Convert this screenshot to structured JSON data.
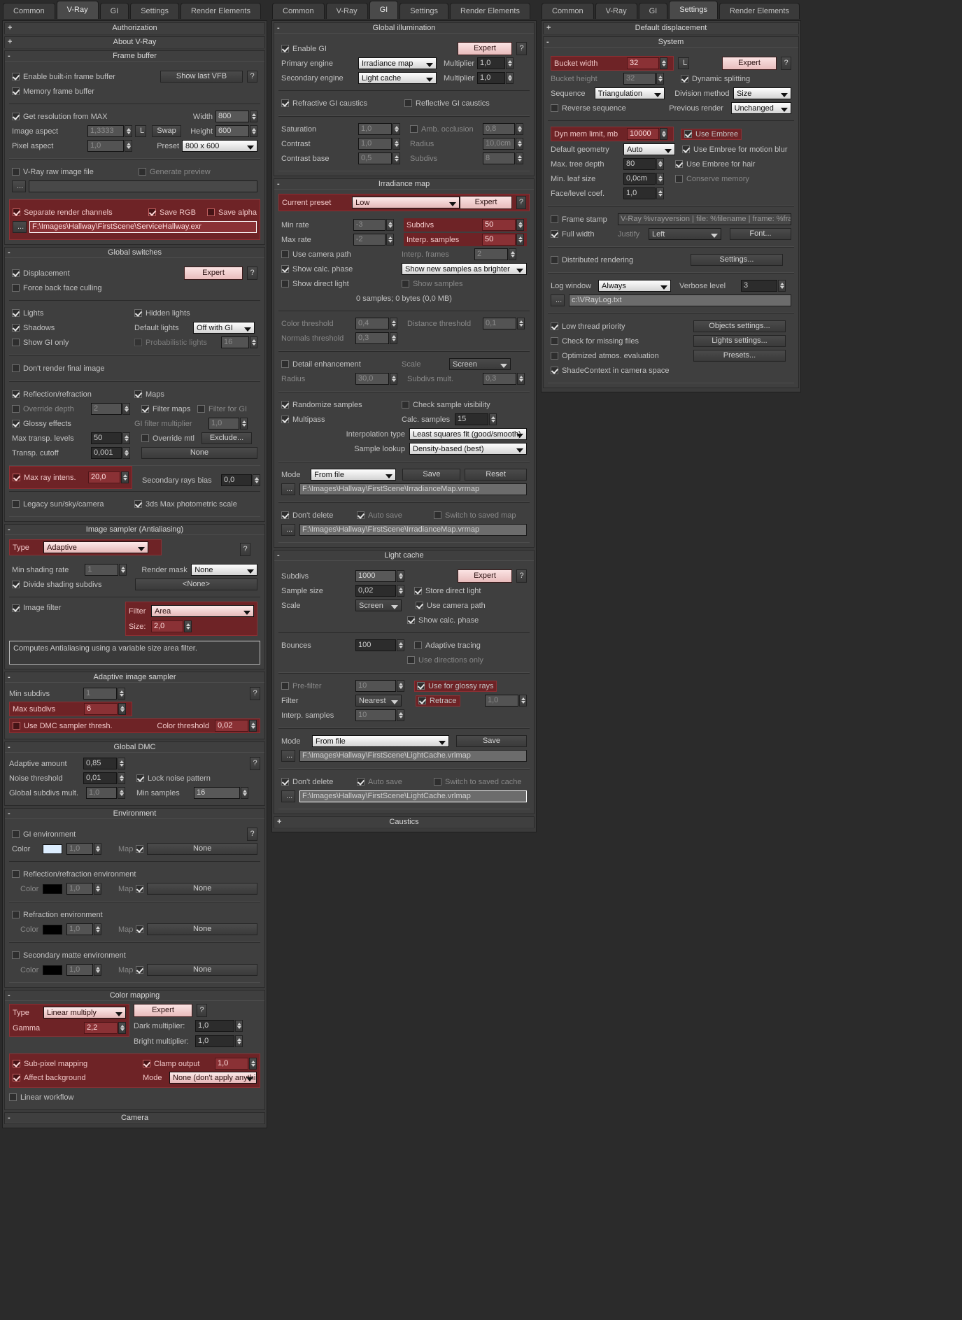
{
  "columns": [
    {
      "id": "vray",
      "tabs": [
        "Common",
        "V-Ray",
        "GI",
        "Settings",
        "Render Elements"
      ],
      "active_tab": "V-Ray"
    },
    {
      "id": "gi",
      "tabs": [
        "Common",
        "V-Ray",
        "GI",
        "Settings",
        "Render Elements"
      ],
      "active_tab": "GI"
    },
    {
      "id": "settings",
      "tabs": [
        "Common",
        "V-Ray",
        "GI",
        "Settings",
        "Render Elements"
      ],
      "active_tab": "Settings"
    }
  ],
  "vray": {
    "authorization": {
      "title": "Authorization",
      "state": "+"
    },
    "about": {
      "title": "About V-Ray",
      "state": "+"
    },
    "frame_buffer": {
      "title": "Frame buffer",
      "state": "-",
      "enable_builtin": "Enable built-in frame buffer",
      "memory_frame_buffer": "Memory frame buffer",
      "show_last_vfb": "Show last VFB",
      "help": "?",
      "get_resolution": "Get resolution from MAX",
      "image_aspect_label": "Image aspect",
      "image_aspect_value": "1,3333",
      "pixel_aspect_label": "Pixel aspect",
      "pixel_aspect_value": "1,0",
      "lock_label": "L",
      "swap": "Swap",
      "width_label": "Width",
      "width_value": "800",
      "height_label": "Height",
      "height_value": "600",
      "preset_label": "Preset",
      "preset_value": "800 x 600",
      "raw_image_file": "V-Ray raw image file",
      "generate_preview": "Generate preview",
      "raw_path": "",
      "dots": "...",
      "separate_render_channels": "Separate render channels",
      "save_rgb": "Save RGB",
      "save_alpha": "Save alpha",
      "channels_path": "F:\\Images\\Hallway\\FirstScene\\ServiceHallway.exr"
    },
    "global_switches": {
      "title": "Global switches",
      "state": "-",
      "displacement": "Displacement",
      "force_back_face_culling": "Force back face culling",
      "expert": "Expert",
      "help": "?",
      "lights": "Lights",
      "shadows": "Shadows",
      "show_gi_only": "Show GI only",
      "hidden_lights": "Hidden lights",
      "default_lights_label": "Default lights",
      "default_lights_value": "Off with GI",
      "probabilistic_lights": "Probabilistic lights",
      "probabilistic_lights_value": "16",
      "dont_render_final": "Don't render final image",
      "reflection_refraction": "Reflection/refraction",
      "override_depth": "Override depth",
      "override_depth_value": "2",
      "glossy_effects": "Glossy effects",
      "max_transp_levels_label": "Max transp. levels",
      "max_transp_levels_value": "50",
      "transp_cutoff_label": "Transp. cutoff",
      "transp_cutoff_value": "0,001",
      "maps": "Maps",
      "filter_maps": "Filter maps",
      "filter_for_gi": "Filter for GI",
      "gi_filter_multiplier_label": "GI filter multiplier",
      "gi_filter_multiplier_value": "1,0",
      "override_mtl": "Override mtl",
      "exclude": "Exclude...",
      "override_mtl_slot": "None",
      "max_ray_intens": "Max ray intens.",
      "max_ray_intens_value": "20,0",
      "secondary_rays_bias_label": "Secondary rays bias",
      "secondary_rays_bias_value": "0,0",
      "legacy_sun": "Legacy sun/sky/camera",
      "photometric_scale": "3ds Max photometric scale"
    },
    "image_sampler": {
      "title": "Image sampler (Antialiasing)",
      "state": "-",
      "type_label": "Type",
      "type_value": "Adaptive",
      "help": "?",
      "min_shading_rate_label": "Min shading rate",
      "min_shading_rate_value": "1",
      "render_mask_label": "Render mask",
      "render_mask_value": "None",
      "divide_shading_subdivs": "Divide shading subdivs",
      "mask_slot": "<None>",
      "image_filter": "Image filter",
      "filter_label": "Filter",
      "filter_value": "Area",
      "size_label": "Size:",
      "size_value": "2,0",
      "description": "Computes Antialiasing using a variable size area filter."
    },
    "adaptive_image_sampler": {
      "title": "Adaptive image sampler",
      "state": "-",
      "min_subdivs_label": "Min subdivs",
      "min_subdivs_value": "1",
      "max_subdivs_label": "Max subdivs",
      "max_subdivs_value": "6",
      "help": "?",
      "use_dmc_sampler_thresh": "Use DMC sampler thresh.",
      "color_threshold_label": "Color threshold",
      "color_threshold_value": "0,02"
    },
    "global_dmc": {
      "title": "Global DMC",
      "state": "-",
      "adaptive_amount_label": "Adaptive amount",
      "adaptive_amount_value": "0,85",
      "help": "?",
      "noise_threshold_label": "Noise threshold",
      "noise_threshold_value": "0,01",
      "lock_noise_pattern": "Lock noise pattern",
      "global_subdivs_mult_label": "Global subdivs mult.",
      "global_subdivs_mult_value": "1,0",
      "min_samples_label": "Min samples",
      "min_samples_value": "16"
    },
    "environment": {
      "title": "Environment",
      "state": "-",
      "help": "?",
      "gi_environment": "GI environment",
      "gi_color": "#ddeeff",
      "gi_mult": "1,0",
      "gi_map_label": "Map",
      "gi_map_value": "None",
      "color_label": "Color",
      "refl_environment": "Reflection/refraction environment",
      "refl_color": "#000000",
      "refl_mult": "1,0",
      "refl_map_value": "None",
      "refr_environment": "Refraction environment",
      "refr_color": "#000000",
      "refr_mult": "1,0",
      "refr_map_value": "None",
      "matte_environment": "Secondary matte environment",
      "matte_color": "#000000",
      "matte_mult": "1,0",
      "matte_map_value": "None",
      "map_label": "Map"
    },
    "color_mapping": {
      "title": "Color mapping",
      "state": "-",
      "type_label": "Type",
      "type_value": "Linear multiply",
      "expert": "Expert",
      "help": "?",
      "gamma_label": "Gamma",
      "gamma_value": "2,2",
      "dark_multiplier_label": "Dark multiplier:",
      "dark_multiplier_value": "1,0",
      "bright_multiplier_label": "Bright multiplier:",
      "bright_multiplier_value": "1,0",
      "sub_pixel_mapping": "Sub-pixel mapping",
      "affect_background": "Affect background",
      "linear_workflow": "Linear workflow",
      "clamp_output": "Clamp output",
      "clamp_level_value": "1,0",
      "mode_label": "Mode",
      "mode_value": "None (don't apply anything)"
    },
    "camera": {
      "title": "Camera",
      "state": "-"
    }
  },
  "gi": {
    "global_illumination": {
      "title": "Global illumination",
      "state": "-",
      "enable_gi": "Enable GI",
      "expert": "Expert",
      "help": "?",
      "primary_engine_label": "Primary engine",
      "primary_engine_value": "Irradiance map",
      "primary_multiplier_label": "Multiplier",
      "primary_multiplier_value": "1,0",
      "secondary_engine_label": "Secondary engine",
      "secondary_engine_value": "Light cache",
      "secondary_multiplier_label": "Multiplier",
      "secondary_multiplier_value": "1,0",
      "refractive_caustics": "Refractive GI caustics",
      "reflective_caustics": "Reflective GI caustics",
      "saturation_label": "Saturation",
      "saturation_value": "1,0",
      "contrast_label": "Contrast",
      "contrast_value": "1,0",
      "contrast_base_label": "Contrast base",
      "contrast_base_value": "0,5",
      "amb_occlusion": "Amb. occlusion",
      "amb_occlusion_value": "0,8",
      "radius_label": "Radius",
      "radius_value": "10,0cm",
      "subdivs_label": "Subdivs",
      "subdivs_value": "8"
    },
    "irradiance_map": {
      "title": "Irradiance map",
      "state": "-",
      "current_preset_label": "Current preset",
      "current_preset_value": "Low",
      "expert": "Expert",
      "help": "?",
      "min_rate_label": "Min rate",
      "min_rate_value": "-3",
      "max_rate_label": "Max rate",
      "max_rate_value": "-2",
      "subdivs_label": "Subdivs",
      "subdivs_value": "50",
      "interp_samples_label": "Interp. samples",
      "interp_samples_value": "50",
      "interp_frames_label": "Interp. frames",
      "interp_frames_value": "2",
      "use_camera_path": "Use camera path",
      "show_calc_phase": "Show calc. phase",
      "show_direct_light": "Show direct light",
      "display_mode_value": "Show new samples as brighter",
      "show_samples": "Show samples",
      "stats": "0 samples; 0 bytes (0,0 MB)",
      "color_threshold_label": "Color threshold",
      "color_threshold_value": "0,4",
      "normals_threshold_label": "Normals threshold",
      "normals_threshold_value": "0,3",
      "distance_threshold_label": "Distance threshold",
      "distance_threshold_value": "0,1",
      "detail_enhancement": "Detail enhancement",
      "scale_label": "Scale",
      "scale_value": "Screen",
      "de_radius_label": "Radius",
      "de_radius_value": "30,0",
      "subdivs_mult_label": "Subdivs mult.",
      "subdivs_mult_value": "0,3",
      "randomize_samples": "Randomize samples",
      "check_sample_visibility": "Check sample visibility",
      "multipass": "Multipass",
      "calc_samples_label": "Calc. samples",
      "calc_samples_value": "15",
      "interpolation_type_label": "Interpolation type",
      "interpolation_type_value": "Least squares fit (good/smooth)",
      "sample_lookup_label": "Sample lookup",
      "sample_lookup_value": "Density-based (best)",
      "mode_label": "Mode",
      "mode_value": "From file",
      "save": "Save",
      "reset": "Reset",
      "dots": "...",
      "file_path": "F:\\Images\\Hallway\\FirstScene\\IrradianceMap.vrmap",
      "dont_delete": "Don't delete",
      "auto_save": "Auto save",
      "switch_to_saved_map": "Switch to saved map",
      "auto_save_path": "F:\\Images\\Hallway\\FirstScene\\IrradianceMap.vrmap"
    },
    "light_cache": {
      "title": "Light cache",
      "state": "-",
      "subdivs_label": "Subdivs",
      "subdivs_value": "1000",
      "expert": "Expert",
      "help": "?",
      "sample_size_label": "Sample size",
      "sample_size_value": "0,02",
      "store_direct_light": "Store direct light",
      "scale_label": "Scale",
      "scale_value": "Screen",
      "use_camera_path": "Use camera path",
      "show_calc_phase": "Show calc. phase",
      "bounces_label": "Bounces",
      "bounces_value": "100",
      "adaptive_tracing": "Adaptive tracing",
      "use_directions_only": "Use directions only",
      "pre_filter": "Pre-filter",
      "pre_filter_value": "10",
      "use_for_glossy_rays": "Use for glossy rays",
      "filter_label": "Filter",
      "filter_value": "Nearest",
      "retrace": "Retrace",
      "retrace_value": "1,0",
      "interp_samples_label": "Interp. samples",
      "interp_samples_value": "10",
      "mode_label": "Mode",
      "mode_value": "From file",
      "save": "Save",
      "dots": "...",
      "file_path": "F:\\Images\\Hallway\\FirstScene\\LightCache.vrlmap",
      "dont_delete": "Don't delete",
      "auto_save": "Auto save",
      "switch_to_saved_cache": "Switch to saved cache",
      "auto_save_path": "F:\\Images\\Hallway\\FirstScene\\LightCache.vrlmap"
    },
    "caustics": {
      "title": "Caustics",
      "state": "+"
    }
  },
  "settings": {
    "default_displacement": {
      "title": "Default displacement",
      "state": "+"
    },
    "system": {
      "title": "System",
      "state": "-",
      "bucket_width_label": "Bucket width",
      "bucket_width_value": "32",
      "lock_label": "L",
      "expert": "Expert",
      "help": "?",
      "bucket_height_label": "Bucket height",
      "bucket_height_value": "32",
      "dynamic_splitting": "Dynamic splitting",
      "sequence_label": "Sequence",
      "sequence_value": "Triangulation",
      "division_method_label": "Division method",
      "division_method_value": "Size",
      "reverse_sequence": "Reverse sequence",
      "previous_render_label": "Previous render",
      "previous_render_value": "Unchanged",
      "dyn_mem_limit_label": "Dyn mem limit, mb",
      "dyn_mem_limit_value": "10000",
      "use_embree": "Use Embree",
      "default_geometry_label": "Default geometry",
      "default_geometry_value": "Auto",
      "embree_motion_blur": "Use Embree for motion blur",
      "max_tree_depth_label": "Max. tree depth",
      "max_tree_depth_value": "80",
      "embree_hair": "Use Embree for hair",
      "min_leaf_size_label": "Min. leaf size",
      "min_leaf_size_value": "0,0cm",
      "conserve_memory": "Conserve memory",
      "face_level_coef_label": "Face/level coef.",
      "face_level_coef_value": "1,0",
      "frame_stamp": "Frame stamp",
      "frame_stamp_value": "V-Ray %vrayversion | file: %filename | frame: %frame | prim",
      "full_width": "Full width",
      "justify_label": "Justify",
      "justify_value": "Left",
      "font_btn": "Font...",
      "distributed_rendering": "Distributed rendering",
      "dr_settings_btn": "Settings...",
      "log_window_label": "Log window",
      "log_window_value": "Always",
      "verbose_level_label": "Verbose level",
      "verbose_level_value": "3",
      "dots": "...",
      "log_path": "c:\\VRayLog.txt",
      "low_thread_priority": "Low thread priority",
      "check_missing_files": "Check for missing files",
      "optimized_atmos": "Optimized atmos. evaluation",
      "shadecontext_camera_space": "ShadeContext in camera space",
      "objects_settings_btn": "Objects settings...",
      "lights_settings_btn": "Lights settings...",
      "presets_btn": "Presets..."
    }
  }
}
